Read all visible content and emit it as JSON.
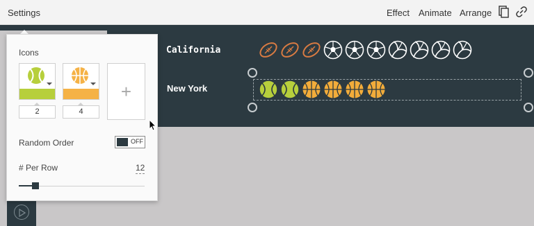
{
  "toolbar": {
    "settings_label": "Settings",
    "effect_label": "Effect",
    "animate_label": "Animate",
    "arrange_label": "Arrange",
    "icons": [
      "copy-icon",
      "link-icon"
    ]
  },
  "canvas": {
    "rows": [
      {
        "label": "California",
        "icons": [
          "football",
          "football",
          "football",
          "soccer",
          "soccer",
          "soccer",
          "volleyball",
          "volleyball",
          "volleyball",
          "volleyball"
        ]
      },
      {
        "label": "New York",
        "icons": [
          "tennis",
          "tennis",
          "basketball",
          "basketball",
          "basketball",
          "basketball"
        ]
      }
    ],
    "colors": {
      "background": "#2c3a41",
      "football": "#d97b42",
      "tennis": "#b7cf3c",
      "basketball": "#f2ac3a",
      "outline": "#ffffff"
    }
  },
  "popover": {
    "title": "Icons",
    "items": [
      {
        "icon": "tennis-ball-icon",
        "color": "#b7cf3c",
        "count": "2"
      },
      {
        "icon": "basketball-icon",
        "color": "#f5b246",
        "count": "4"
      }
    ],
    "add_label": "+",
    "random_order_label": "Random Order",
    "random_order_toggle": "OFF",
    "per_row_label": "# Per Row",
    "per_row_value": "12",
    "per_row_slider_fraction": 0.13
  }
}
